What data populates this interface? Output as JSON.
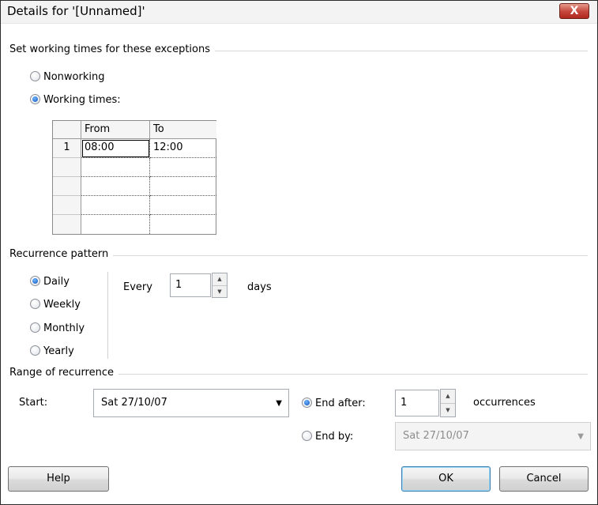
{
  "window": {
    "title": "Details for '[Unnamed]'",
    "close_label": "X"
  },
  "exceptions": {
    "section_title": "Set working times for these exceptions",
    "nonworking_label": "Nonworking",
    "working_times_label": "Working times:",
    "selected": "working_times"
  },
  "times_grid": {
    "columns": [
      "From",
      "To"
    ],
    "rows": [
      {
        "num": "1",
        "from": "08:00",
        "to": "12:00"
      },
      {
        "num": "",
        "from": "",
        "to": ""
      },
      {
        "num": "",
        "from": "",
        "to": ""
      },
      {
        "num": "",
        "from": "",
        "to": ""
      },
      {
        "num": "",
        "from": "",
        "to": ""
      }
    ]
  },
  "recurrence": {
    "section_title": "Recurrence pattern",
    "options": [
      "Daily",
      "Weekly",
      "Monthly",
      "Yearly"
    ],
    "selected": "Daily",
    "every_label": "Every",
    "every_value": "1",
    "unit_label": "days"
  },
  "range": {
    "section_title": "Range of recurrence",
    "start_label": "Start:",
    "start_value": "Sat 27/10/07",
    "end_after_label": "End after:",
    "end_after_value": "1",
    "occurrences_label": "occurrences",
    "end_by_label": "End by:",
    "end_by_value": "Sat 27/10/07",
    "selected": "end_after"
  },
  "buttons": {
    "help": "Help",
    "ok": "OK",
    "cancel": "Cancel"
  },
  "icons": {
    "close": "close-icon",
    "spin_up": "chevron-up-icon",
    "spin_down": "chevron-down-icon",
    "dropdown": "dropdown-arrow-icon"
  }
}
